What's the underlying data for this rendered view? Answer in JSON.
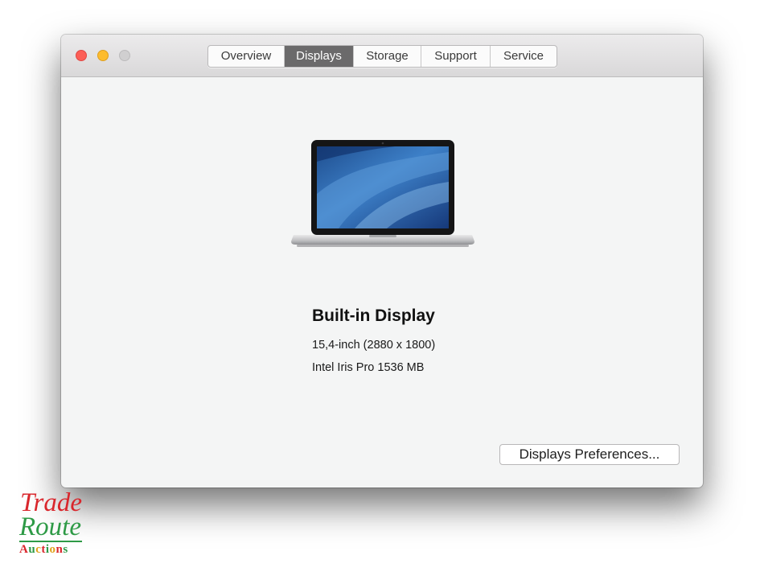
{
  "window": {
    "tabs": [
      {
        "label": "Overview",
        "active": false
      },
      {
        "label": "Displays",
        "active": true
      },
      {
        "label": "Storage",
        "active": false
      },
      {
        "label": "Support",
        "active": false
      },
      {
        "label": "Service",
        "active": false
      }
    ]
  },
  "display": {
    "icon": "macbook-pro-laptop",
    "name": "Built-in Display",
    "size_resolution": "15,4-inch (2880 x 1800)",
    "graphics": "Intel Iris Pro 1536 MB"
  },
  "buttons": {
    "preferences": "Displays Preferences..."
  },
  "watermark": {
    "line1": "Trade",
    "line2": "Route",
    "line3": "Auctions"
  },
  "colors": {
    "close": "#fc5f57",
    "minimize": "#fdbc2e",
    "zoom": "#d0cfd0",
    "active_tab": "#6b6a6b",
    "logo_red": "#d9262c",
    "logo_green": "#2e9a46"
  }
}
